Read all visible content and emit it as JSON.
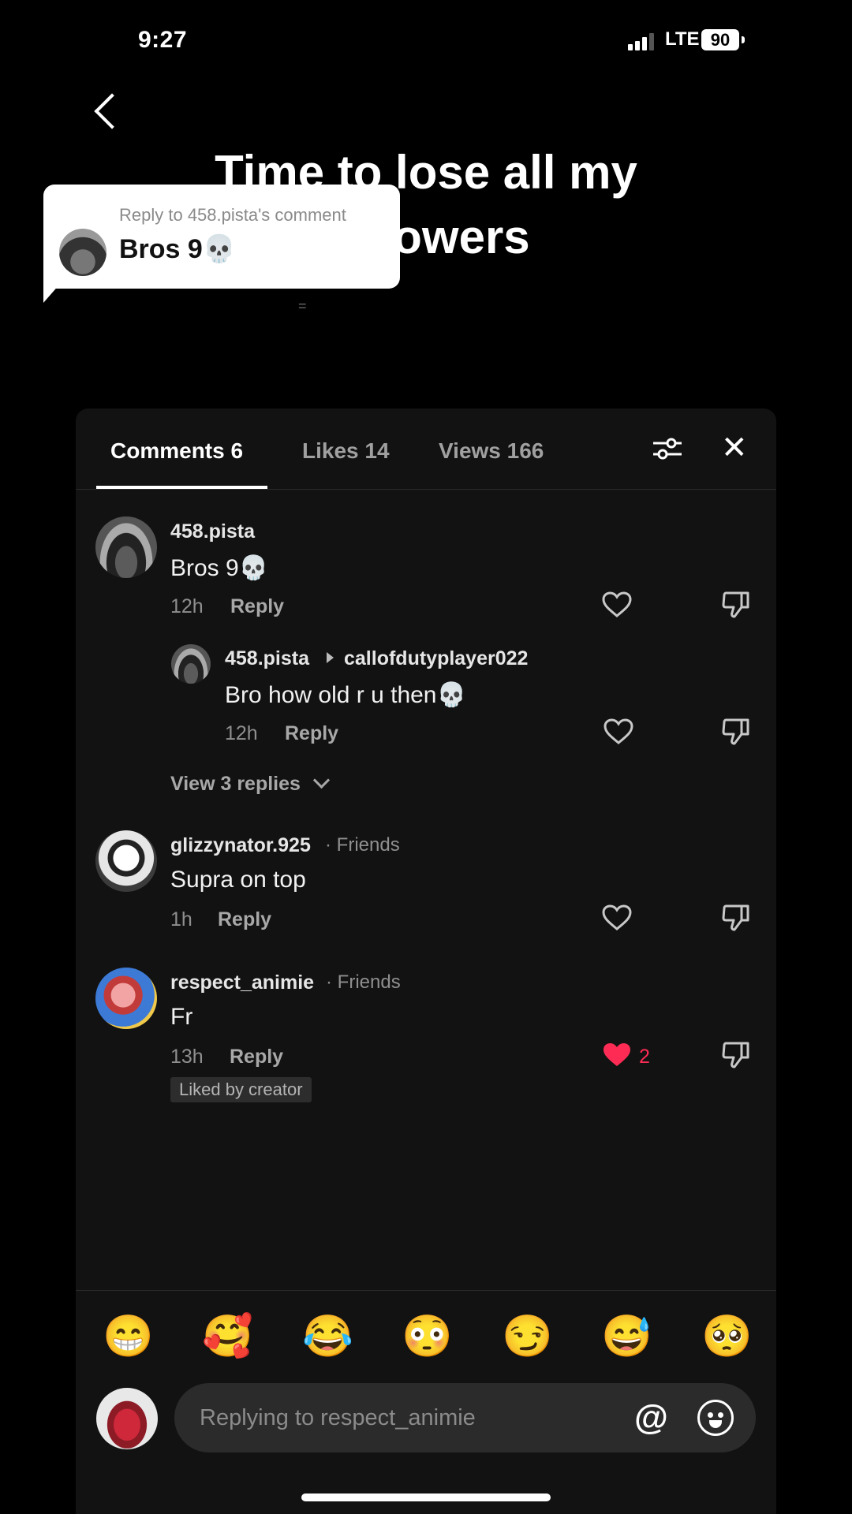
{
  "status_bar": {
    "time": "9:27",
    "network": "LTE",
    "battery": "90"
  },
  "video": {
    "title_line1": "Time to lose all my",
    "title_line2": "followers",
    "small_mark": "="
  },
  "reply_sticker": {
    "header": "Reply to 458.pista's comment",
    "text": "Bros 9💀"
  },
  "tabs": [
    {
      "label": "Comments 6"
    },
    {
      "label": "Likes 14"
    },
    {
      "label": "Views 166"
    }
  ],
  "comments": [
    {
      "username": "458.pista",
      "text": "Bros 9💀",
      "time": "12h",
      "reply": "Reply"
    },
    {
      "username": "glizzynator.925",
      "friends": "· Friends",
      "text": "Supra on top",
      "time": "1h",
      "reply": "Reply"
    },
    {
      "username": "respect_animie",
      "friends": "· Friends",
      "text": "Fr",
      "time": "13h",
      "reply": "Reply",
      "likes": "2",
      "badge": "Liked by creator"
    }
  ],
  "nested_reply": {
    "username": "458.pista",
    "reply_to": "callofdutyplayer022",
    "text": "Bro how old r u then💀",
    "time": "12h",
    "reply": "Reply"
  },
  "view_replies": "View 3 replies",
  "emojis": [
    "😁",
    "🥰",
    "😂",
    "😳",
    "😏",
    "😅",
    "🥺"
  ],
  "input": {
    "placeholder": "Replying to respect_animie"
  },
  "colors": {
    "like_red": "#fe2c55",
    "panel_bg": "#121212",
    "input_bg": "#2b2b2b"
  },
  "icons": [
    "back-icon",
    "filter-icon",
    "close-icon",
    "heart-icon",
    "dislike-icon",
    "at-icon",
    "emoji-icon"
  ]
}
